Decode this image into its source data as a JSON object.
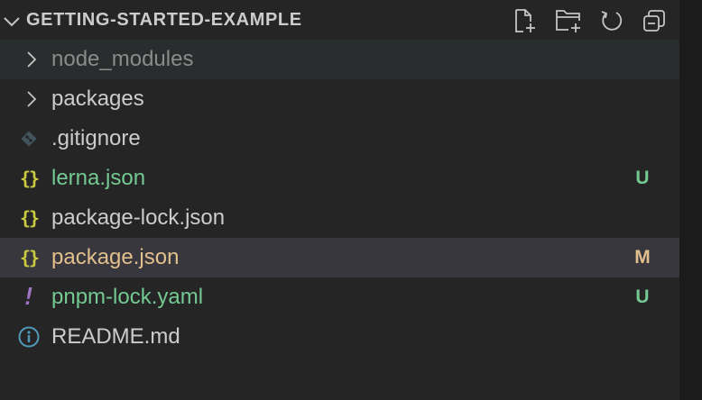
{
  "header": {
    "title": "GETTING-STARTED-EXAMPLE",
    "actions": [
      {
        "name": "new-file-button",
        "icon": "new-file-icon"
      },
      {
        "name": "new-folder-button",
        "icon": "new-folder-icon"
      },
      {
        "name": "refresh-button",
        "icon": "refresh-icon"
      },
      {
        "name": "collapse-all-button",
        "icon": "collapse-all-icon"
      }
    ]
  },
  "tree": {
    "items": [
      {
        "label": "node_modules",
        "type": "folder",
        "color": "#8b8b8b",
        "badge": ""
      },
      {
        "label": "packages",
        "type": "folder",
        "color": "#cccccc",
        "badge": ""
      },
      {
        "label": ".gitignore",
        "type": "file",
        "icon": "git-icon",
        "color": "#cccccc",
        "badge": ""
      },
      {
        "label": "lerna.json",
        "type": "file",
        "icon": "json-icon",
        "color": "#73c991",
        "badge": "U",
        "badge_color": "#73c991"
      },
      {
        "label": "package-lock.json",
        "type": "file",
        "icon": "json-icon",
        "color": "#cccccc",
        "badge": ""
      },
      {
        "label": "package.json",
        "type": "file",
        "icon": "json-icon",
        "color": "#e2c08d",
        "badge": "M",
        "badge_color": "#e2c08d"
      },
      {
        "label": "pnpm-lock.yaml",
        "type": "file",
        "icon": "yaml-icon",
        "color": "#73c991",
        "badge": "U",
        "badge_color": "#73c991"
      },
      {
        "label": "README.md",
        "type": "file",
        "icon": "info-icon",
        "color": "#cccccc",
        "badge": ""
      }
    ]
  },
  "icon_glyphs": {
    "json": "{}",
    "yaml": "!"
  }
}
